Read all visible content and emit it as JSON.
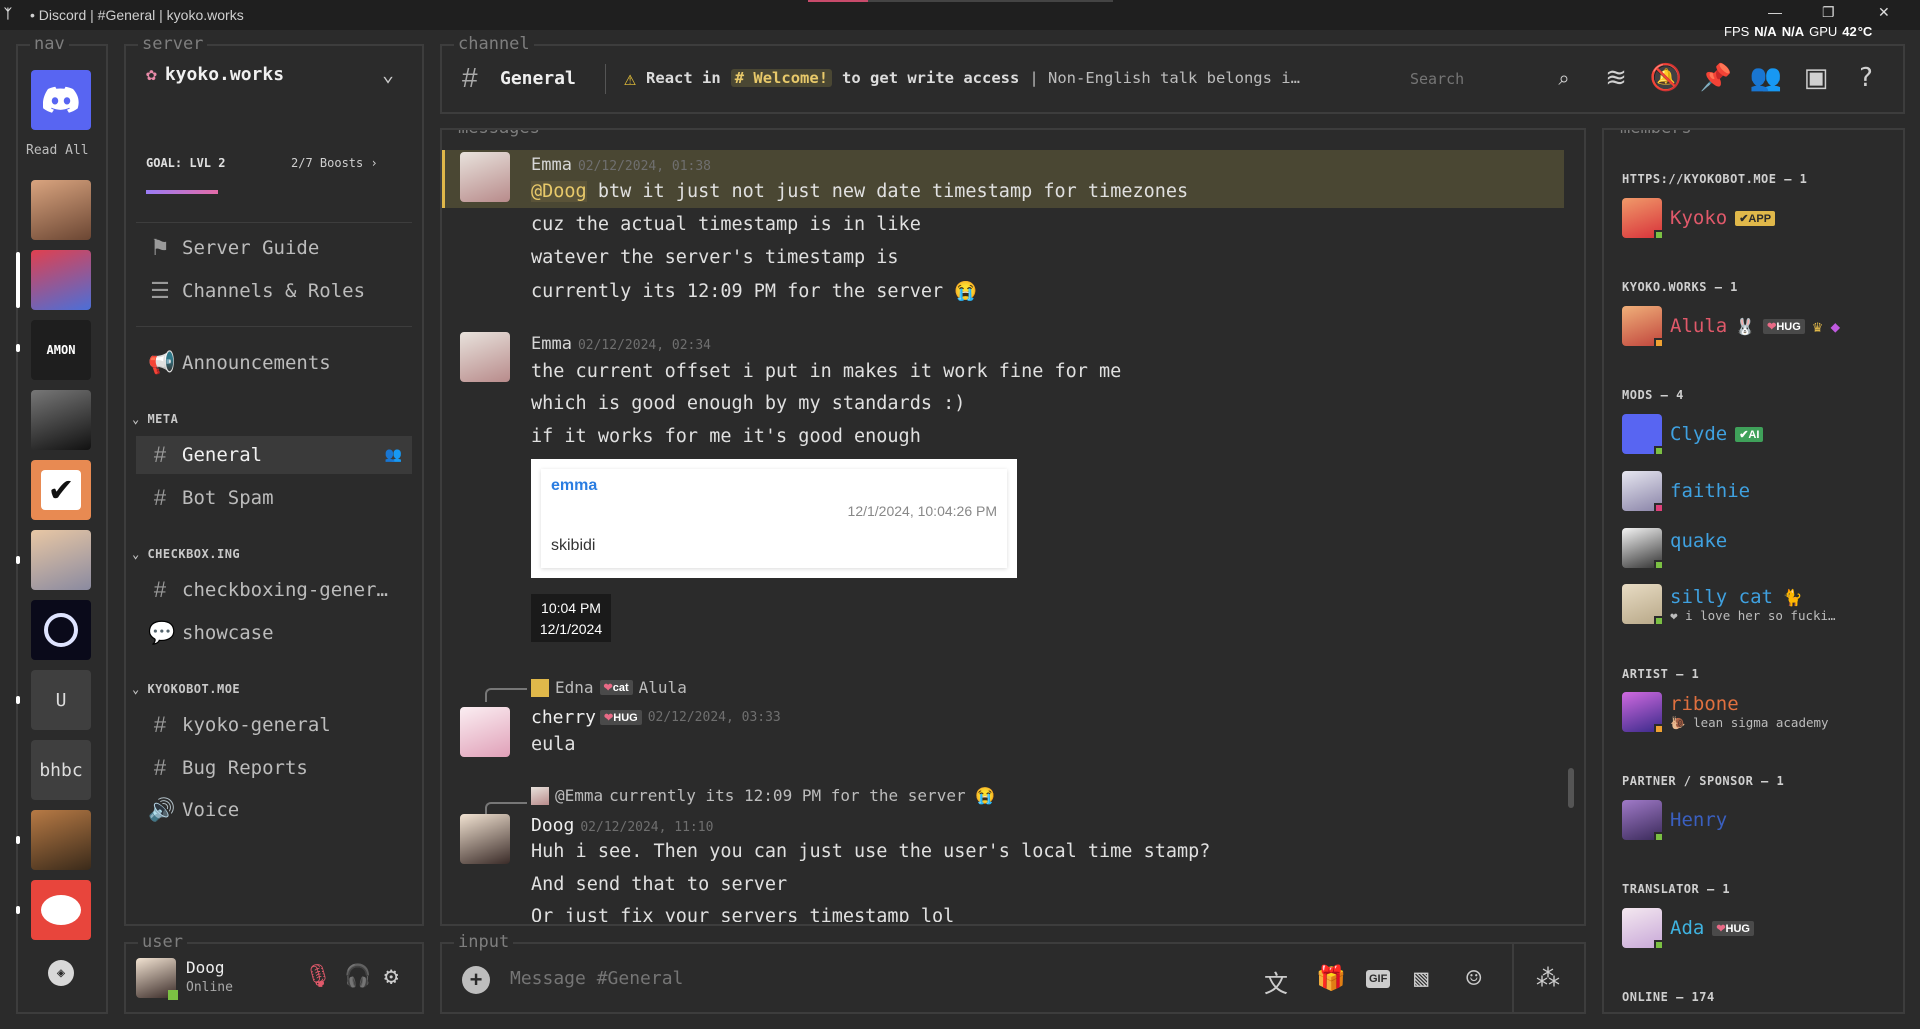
{
  "window": {
    "title": "• Discord | #General | kyoko.works",
    "fps_label": "FPS",
    "fps_value": "N/A",
    "gpu_value": "N/A",
    "gpu_label": "GPU",
    "temp": "42",
    "temp_unit": "°C"
  },
  "panels": {
    "nav": "nav",
    "server": "server",
    "channel": "channel",
    "messages": "messages",
    "members": "members",
    "user": "user",
    "input": "input"
  },
  "nav": {
    "read_all": "Read All",
    "servers": [
      {
        "name": "AMON",
        "label": "AMON"
      },
      {
        "name": "U",
        "label": "U"
      },
      {
        "name": "bhbc",
        "label": "bhbc"
      }
    ]
  },
  "server": {
    "name": "kyoko.works",
    "goal": "GOAL: LVL 2",
    "boosts": "2/7 Boosts",
    "guide": "Server Guide",
    "channels_roles": "Channels & Roles",
    "announcements": "Announcements",
    "categories": [
      {
        "name": "META",
        "channels": [
          "General",
          "Bot Spam"
        ]
      },
      {
        "name": "CHECKBOX.ING",
        "channels": [
          "checkboxing-gener…",
          "showcase"
        ]
      },
      {
        "name": "KYOKOBOT.MOE",
        "channels": [
          "kyoko-general",
          "Bug Reports",
          "Voice"
        ]
      }
    ]
  },
  "channel": {
    "name": "General",
    "topic_prefix": "React in",
    "topic_channel": "Welcome!",
    "topic_mid": "to get write access",
    "topic_rest": "| Non-English talk belongs i…",
    "search_placeholder": "Search"
  },
  "messages": [
    {
      "author": "Emma",
      "timestamp": "02/12/2024, 01:38",
      "mention": "@Doog",
      "lines": [
        "btw it just not just new date timestamp for timezones",
        "cuz the actual timestamp is in like",
        "watever the server's timestamp is",
        "currently its 12:09 PM for the server 😭"
      ]
    },
    {
      "author": "Emma",
      "timestamp": "02/12/2024, 02:34",
      "lines": [
        "the current offset i put in makes it work fine for me",
        "which is good enough by my standards :)",
        "if it works for me it's good enough"
      ],
      "embed": {
        "name": "emma",
        "time": "12/1/2024, 10:04:26 PM",
        "text": "skibidi"
      },
      "clock": {
        "time": "10:04 PM",
        "date": "12/1/2024"
      }
    },
    {
      "reply_author": "Edna",
      "reply_tag": "cat",
      "reply_text": "Alula",
      "author": "cherry",
      "author_tag": "HUG",
      "timestamp": "02/12/2024, 03:33",
      "lines": [
        "eula"
      ]
    },
    {
      "reply_author": "@Emma",
      "reply_text": "currently its 12:09 PM for the server 😭",
      "author": "Doog",
      "timestamp": "02/12/2024, 11:10",
      "lines": [
        "Huh i see. Then you can just use the user's local time stamp?",
        "And send that to server",
        "Or just fix your servers timestamp lol"
      ]
    }
  ],
  "members": {
    "groups": [
      {
        "title": "HTTPS://KYOKOBOT.MOE — 1",
        "members": [
          {
            "name": "Kyoko",
            "color": "#e0596a",
            "tag": "✔APP"
          }
        ]
      },
      {
        "title": "KYOKO.WORKS — 1",
        "members": [
          {
            "name": "Alula",
            "color": "#e0596a",
            "tag": "HUG"
          }
        ]
      },
      {
        "title": "MODS — 4",
        "members": [
          {
            "name": "Clyde",
            "color": "#3fa1e0",
            "tag": "✔AI"
          },
          {
            "name": "faithie",
            "color": "#3fa1e0"
          },
          {
            "name": "quake",
            "color": "#3fa1e0"
          },
          {
            "name": "silly cat",
            "color": "#3fa1e0",
            "status": "i love her so fucki…"
          }
        ]
      },
      {
        "title": "ARTIST — 1",
        "members": [
          {
            "name": "ribone",
            "color": "#e0703f",
            "status": "lean sigma academy"
          }
        ]
      },
      {
        "title": "PARTNER / SPONSOR — 1",
        "members": [
          {
            "name": "Henry",
            "color": "#3a5fc0"
          }
        ]
      },
      {
        "title": "TRANSLATOR — 1",
        "members": [
          {
            "name": "Ada",
            "color": "#3fb3e0",
            "tag": "HUG"
          }
        ]
      }
    ],
    "online": "ONLINE — 174"
  },
  "user": {
    "name": "Doog",
    "status": "Online"
  },
  "input": {
    "placeholder": "Message #General"
  },
  "colors": {
    "accent": "#c94b6b",
    "highlight": "#4a4733",
    "mention_bg": "#4a4733",
    "mention": "#e8c96a"
  }
}
